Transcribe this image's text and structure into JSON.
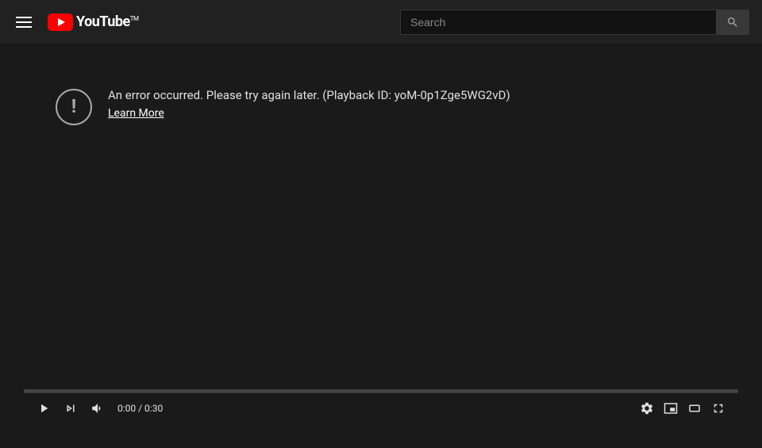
{
  "header": {
    "search_placeholder": "Search",
    "youtube_label": "YouTube",
    "superscript": "TM"
  },
  "player": {
    "error_message": "An error occurred. Please try again later. (Playback ID: yoM-0p1Zge5WG2vD)",
    "learn_more_label": "Learn More",
    "time_current": "0:00",
    "time_total": "0:30",
    "time_display": "0:00 / 0:30"
  }
}
